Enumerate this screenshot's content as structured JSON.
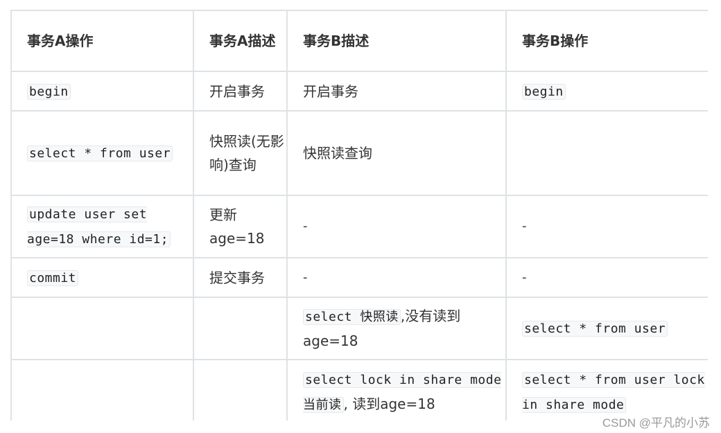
{
  "table": {
    "headers": [
      "事务A操作",
      "事务A描述",
      "事务B描述",
      "事务B操作"
    ],
    "rows": [
      {
        "a_op": "begin",
        "a_desc": "开启事务",
        "b_desc": "开启事务",
        "b_op": "begin"
      },
      {
        "a_op": "select * from user",
        "a_desc": "快照读(无影响)查询",
        "b_desc": "快照读查询",
        "b_op": ""
      },
      {
        "a_op": "update user set age=18 where id=1;",
        "a_desc": "更新age=18",
        "b_desc": "-",
        "b_op": "-"
      },
      {
        "a_op": "commit",
        "a_desc": "提交事务",
        "b_desc": "-",
        "b_op": "-"
      },
      {
        "a_op": "",
        "a_desc": "",
        "b_desc_code": "select 快照读",
        "b_desc_text": ",没有读到age=18",
        "b_op": "select * from user"
      },
      {
        "a_op": "",
        "a_desc": "",
        "b_desc_code": "select lock in share mode当前读",
        "b_desc_text": ", 读到age=18",
        "b_op": "select * from user lock in share mode"
      }
    ]
  },
  "watermark": "CSDN @平凡的小苏"
}
